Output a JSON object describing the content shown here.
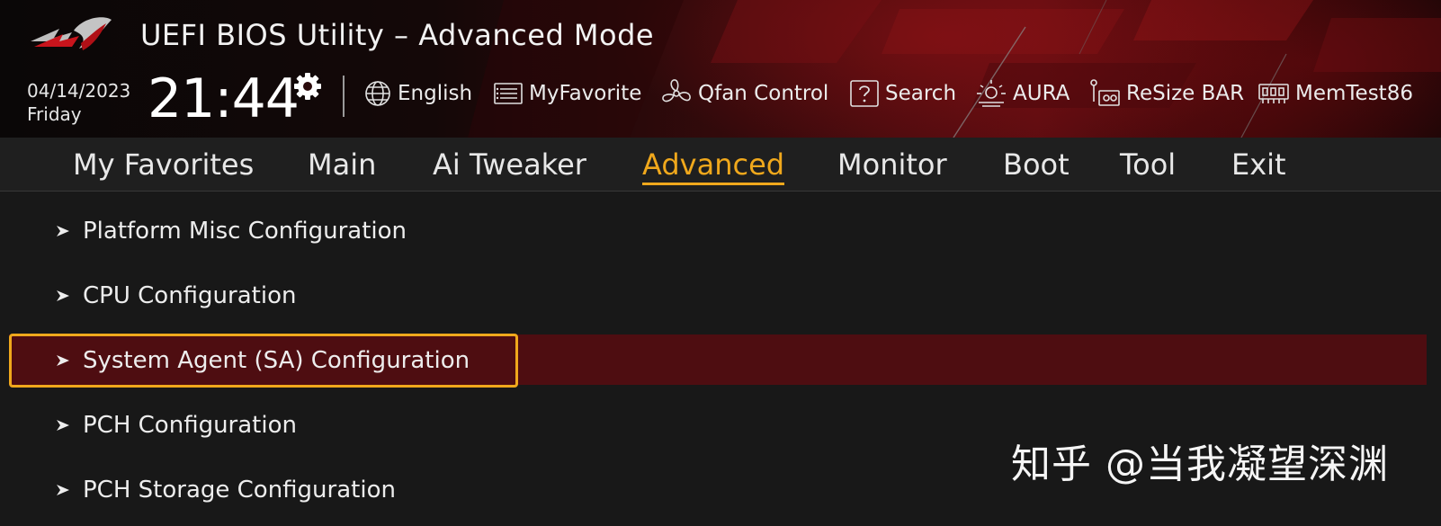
{
  "header": {
    "title": "UEFI BIOS Utility – Advanced Mode",
    "date": "04/14/2023",
    "day": "Friday",
    "time": "21:44",
    "tools": [
      {
        "label": "English",
        "icon": "globe-icon"
      },
      {
        "label": "MyFavorite",
        "icon": "favorite-list-icon"
      },
      {
        "label": "Qfan Control",
        "icon": "fan-icon"
      },
      {
        "label": "Search",
        "icon": "help-search-icon"
      },
      {
        "label": "AURA",
        "icon": "aura-light-icon"
      },
      {
        "label": "ReSize BAR",
        "icon": "resize-bar-icon"
      },
      {
        "label": "MemTest86",
        "icon": "memory-module-icon"
      }
    ]
  },
  "tabs": [
    {
      "label": "My Favorites",
      "active": false
    },
    {
      "label": "Main",
      "active": false
    },
    {
      "label": "Ai Tweaker",
      "active": false
    },
    {
      "label": "Advanced",
      "active": true
    },
    {
      "label": "Monitor",
      "active": false
    },
    {
      "label": "Boot",
      "active": false
    },
    {
      "label": "Tool",
      "active": false
    },
    {
      "label": "Exit",
      "active": false
    }
  ],
  "menu": {
    "items": [
      {
        "label": "Platform Misc Configuration",
        "selected": false
      },
      {
        "label": "CPU Configuration",
        "selected": false
      },
      {
        "label": "System Agent (SA) Configuration",
        "selected": true
      },
      {
        "label": "PCH Configuration",
        "selected": false
      },
      {
        "label": "PCH Storage Configuration",
        "selected": false
      }
    ]
  },
  "watermark": "知乎 @当我凝望深渊",
  "colors": {
    "accent": "#f0a81c",
    "selected_row": "#4e0d11",
    "header_red": "#5a0c10",
    "background": "#181818"
  }
}
